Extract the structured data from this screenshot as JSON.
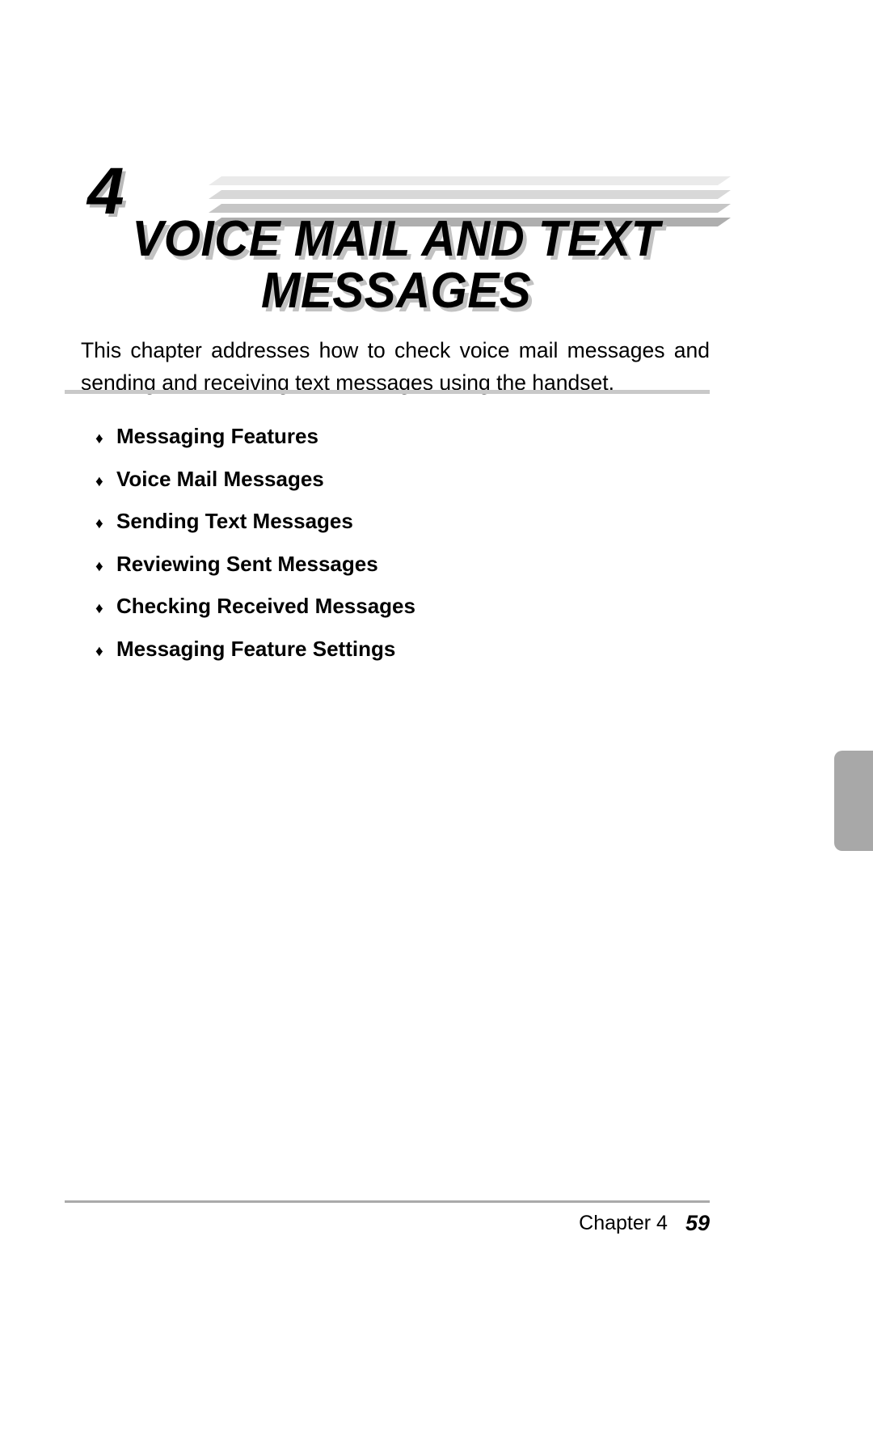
{
  "document": {
    "chapter_number": "4",
    "title": "VOICE MAIL AND TEXT\nMESSAGES",
    "intro": "This chapter addresses how to check voice mail messages and sending and receiving text messages using the handset."
  },
  "toc": {
    "bullet_glyph": "♦",
    "items": [
      {
        "label": "Messaging Features"
      },
      {
        "label": "Voice Mail Messages"
      },
      {
        "label": "Sending Text Messages"
      },
      {
        "label": "Reviewing Sent Messages"
      },
      {
        "label": "Checking Received Messages"
      },
      {
        "label": "Messaging Feature Settings"
      }
    ]
  },
  "footer": {
    "chapter_label": "Chapter 4",
    "page_number": "59"
  },
  "colors": {
    "bar_1": "#eaeaea",
    "bar_2": "#d8d8d8",
    "bar_3": "#c6c6c6",
    "bar_4": "#aeaeae",
    "title_shadow": "#c2c2c2",
    "divider": "#c9c9c9",
    "footer_rule": "#aaaaaa",
    "edge_tab": "#a8a8a8"
  }
}
